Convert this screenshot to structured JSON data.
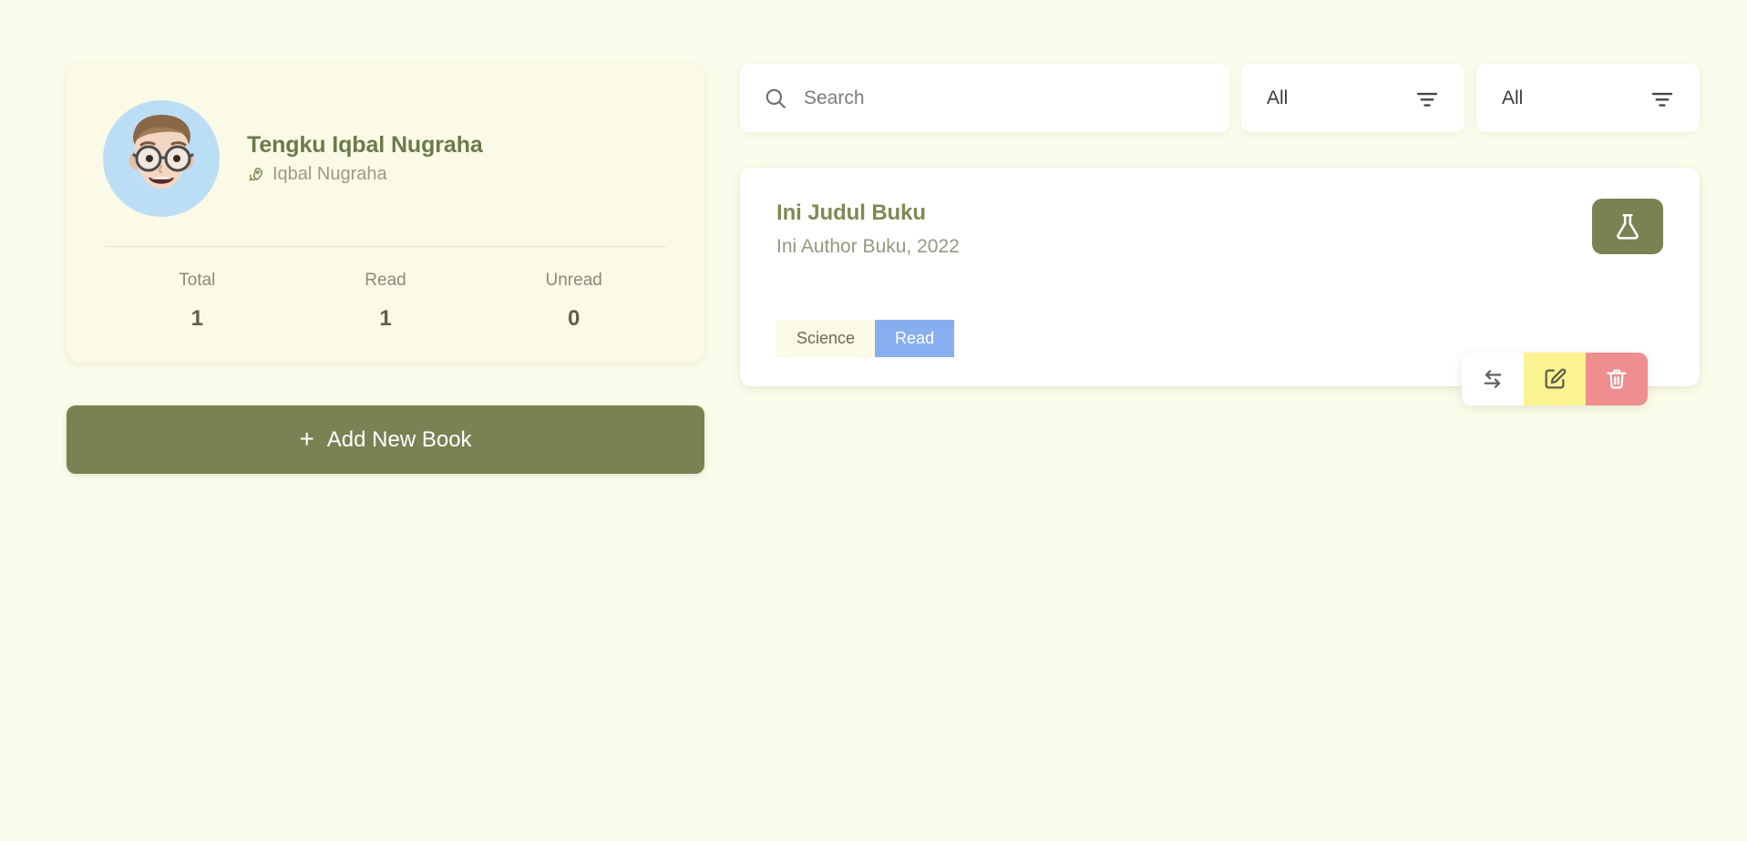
{
  "theme": {
    "page_bg": "#fcfcec",
    "card_cream": "#fafae6",
    "olive": "#798253",
    "olive_text": "#6b7a4a",
    "blue_tag": "#87aeee",
    "avatar_bg": "#bbdef5",
    "edit_yellow": "#fbf38f",
    "delete_red": "#ef8e8e"
  },
  "profile": {
    "name": "Tengku Iqbal Nugraha",
    "username": "Iqbal Nugraha",
    "username_icon": "rocket-icon",
    "avatar_icon": "avatar-memoji",
    "stats": [
      {
        "label": "Total",
        "value": "1"
      },
      {
        "label": "Read",
        "value": "1"
      },
      {
        "label": "Unread",
        "value": "0"
      }
    ]
  },
  "actions": {
    "add_book_label": "Add New Book",
    "add_book_icon": "plus-icon"
  },
  "toolbar": {
    "search": {
      "placeholder": "Search",
      "value": "",
      "icon": "search-icon"
    },
    "filters": [
      {
        "name": "category-filter",
        "value": "All",
        "icon": "filter-icon"
      },
      {
        "name": "status-filter",
        "value": "All",
        "icon": "filter-icon"
      }
    ]
  },
  "books": [
    {
      "title": "Ini Judul Buku",
      "author_year": "Ini Author Buku, 2022",
      "category_tag": "Science",
      "status_tag": "Read",
      "category_icon": "flask-icon",
      "row_actions": [
        {
          "name": "toggle-read-button",
          "icon": "swap-arrows-icon"
        },
        {
          "name": "edit-book-button",
          "icon": "pencil-square-icon"
        },
        {
          "name": "delete-book-button",
          "icon": "trash-icon"
        }
      ]
    }
  ]
}
